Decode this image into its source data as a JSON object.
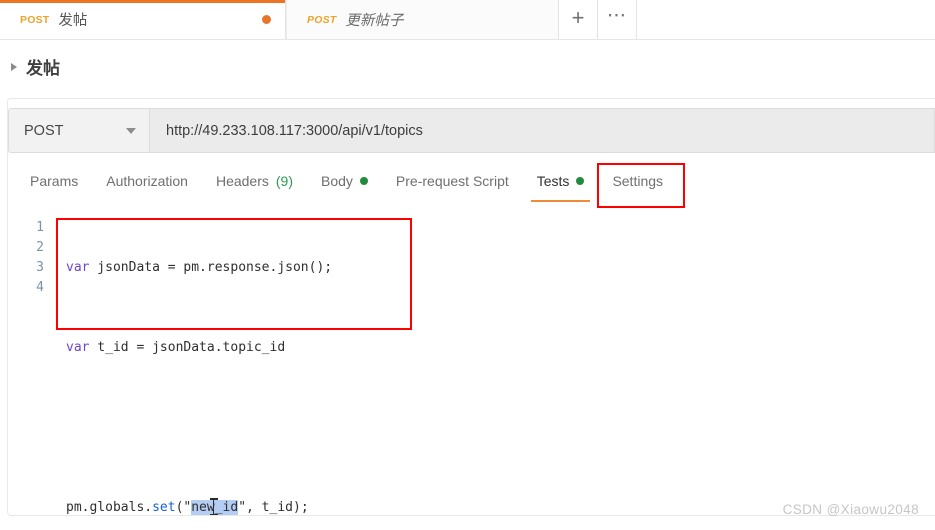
{
  "window": {
    "tabs": [
      {
        "method": "POST",
        "title": "发帖",
        "active": true,
        "unsaved": true
      },
      {
        "method": "POST",
        "title": "更新帖子",
        "active": false,
        "unsaved": false
      }
    ],
    "new_tab_icon": "plus-icon",
    "more_tabs_icon": "ellipsis-icon"
  },
  "breadcrumb": {
    "expand_icon": "caret-right-icon",
    "title": "发帖"
  },
  "request": {
    "method": "POST",
    "method_caret_icon": "chevron-down-icon",
    "url": "http://49.233.108.117:3000/api/v1/topics"
  },
  "section_tabs": [
    {
      "label": "Params",
      "badge": "",
      "dot": false,
      "active": false
    },
    {
      "label": "Authorization",
      "badge": "",
      "dot": false,
      "active": false
    },
    {
      "label": "Headers",
      "badge": "(9)",
      "dot": false,
      "active": false
    },
    {
      "label": "Body",
      "badge": "",
      "dot": true,
      "active": false
    },
    {
      "label": "Pre-request Script",
      "badge": "",
      "dot": false,
      "active": false
    },
    {
      "label": "Tests",
      "badge": "",
      "dot": true,
      "active": true
    },
    {
      "label": "Settings",
      "badge": "",
      "dot": false,
      "active": false
    }
  ],
  "editor": {
    "line_numbers": [
      "1",
      "2",
      "3",
      "4"
    ],
    "lines": [
      {
        "n": "1",
        "kw": "var",
        "rest": " jsonData = pm.response.json();"
      },
      {
        "n": "2",
        "kw": "var",
        "rest": " t_id = jsonData.topic_id"
      },
      {
        "n": "3",
        "kw": "",
        "rest": ""
      },
      {
        "n": "4",
        "kw": "",
        "rest": ""
      }
    ],
    "line4": {
      "prefix": "pm.globals.",
      "fn": "set",
      "open": "(\"",
      "selected": "new_id",
      "close": "\", t_id);"
    }
  },
  "annotations": {
    "color": "#fe0000",
    "tests_tab": "red-box-tests-tab",
    "code_block": "red-box-code-block"
  },
  "watermark": "CSDN @Xiaowu2048",
  "colors": {
    "accent_orange": "#ec7424",
    "method_orange": "#eba42b",
    "green": "#218a3d",
    "annotation_red": "#fe0000"
  }
}
